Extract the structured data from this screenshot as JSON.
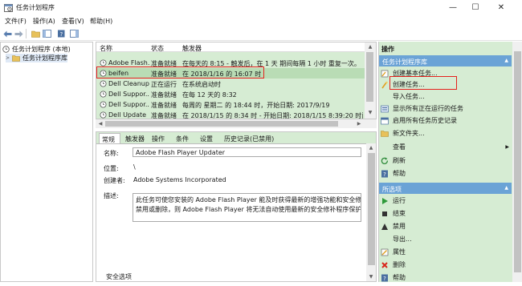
{
  "window": {
    "title": "任务计划程序",
    "minimize": "—",
    "maximize": "☐",
    "close": "✕"
  },
  "menu": [
    "文件(F)",
    "操作(A)",
    "查看(V)",
    "帮助(H)"
  ],
  "tree": {
    "root": "任务计划程序 (本地)",
    "library": "任务计划程序库"
  },
  "task_list": {
    "columns": {
      "name": "名称",
      "status": "状态",
      "trigger": "触发器"
    },
    "rows": [
      {
        "name": "Adobe Flash...",
        "status": "准备就绪",
        "trigger": "在每天的 8:15 - 触发后，在 1 天 期间每隔 1 小时 重复一次。"
      },
      {
        "name": "beifen",
        "status": "准备就绪",
        "trigger": "在 2018/1/16 的 16:07 时"
      },
      {
        "name": "Dell Cleanup",
        "status": "正在运行",
        "trigger": "在系统启动时"
      },
      {
        "name": "Dell Suppor...",
        "status": "准备就绪",
        "trigger": "在每 12 天的 8:32"
      },
      {
        "name": "Dell Suppor...",
        "status": "准备就绪",
        "trigger": "每周的 星期二 的 18:44 时，开始日期: 2017/9/19"
      },
      {
        "name": "Dell Update",
        "status": "准备就绪",
        "trigger": "在 2018/1/15 的 8:34 时 - 开始日期: 2018/1/15 8:39:20 时间(间)"
      }
    ]
  },
  "detail": {
    "tabs": [
      "常规",
      "触发器",
      "操作",
      "条件",
      "设置",
      "历史记录(已禁用)"
    ],
    "name_label": "名称:",
    "name_value": "Adobe Flash Player Updater",
    "location_label": "位置:",
    "location_value": "\\",
    "author_label": "创建者:",
    "author_value": "Adobe Systems Incorporated",
    "desc_label": "描述:",
    "desc_line1": "此任务可使您安装的 Adobe Flash Player 能及时获得最新的增强功能和安全修补程序。",
    "desc_line2": "禁用或删除，则 Adobe Flash Player 将无法自动使用最新的安全修补程序保护您的机",
    "security_label": "安全选项"
  },
  "actions": {
    "title": "操作",
    "section1": "任务计划程序库",
    "items1": [
      {
        "label": "创建基本任务...",
        "icon": "basic-task-icon"
      },
      {
        "label": "创建任务...",
        "icon": "create-task-icon"
      },
      {
        "label": "导入任务...",
        "icon": ""
      },
      {
        "label": "显示所有正在运行的任务",
        "icon": "running-tasks-icon"
      },
      {
        "label": "启用所有任务历史记录",
        "icon": "history-icon"
      },
      {
        "label": "新文件夹...",
        "icon": "folder-icon"
      },
      {
        "label": "查看",
        "icon": ""
      },
      {
        "label": "刷新",
        "icon": "refresh-icon"
      },
      {
        "label": "帮助",
        "icon": "help-icon"
      }
    ],
    "section2": "所选项",
    "items2": [
      {
        "label": "运行",
        "icon": "run-icon"
      },
      {
        "label": "结束",
        "icon": "end-icon"
      },
      {
        "label": "禁用",
        "icon": "disable-icon"
      },
      {
        "label": "导出...",
        "icon": ""
      },
      {
        "label": "属性",
        "icon": "properties-icon"
      },
      {
        "label": "删除",
        "icon": "delete-icon"
      },
      {
        "label": "帮助",
        "icon": "help-icon"
      }
    ]
  },
  "colors": {
    "panel_green": "#d6ecd3",
    "header_blue": "#6ba3d6",
    "highlight_red": "#e5211d"
  }
}
